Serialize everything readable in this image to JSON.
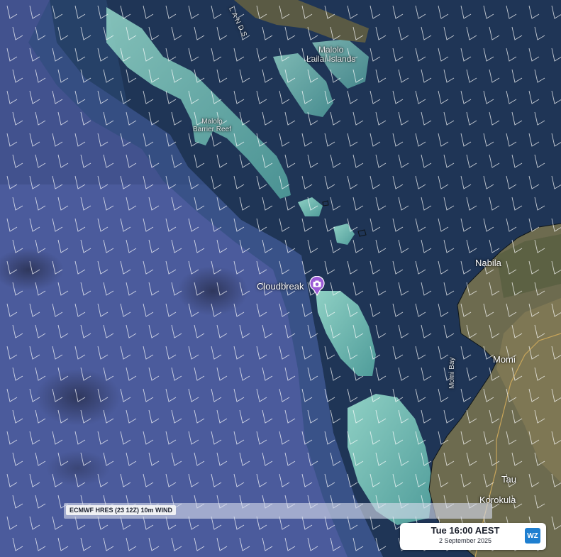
{
  "map": {
    "places": {
      "malolo_lailai": "Malolo\nLailai Islands",
      "malolo_barrier": "Malolo\nBarrier Reef",
      "cloudbreak": "Cloudbreak",
      "nabila": "Nabila",
      "momi": "Momi",
      "momi_bay": "Momi Bay",
      "tau": "Tau",
      "korokula": "Korokula",
      "islands_fragment": "LANDS"
    },
    "colors": {
      "deep_ocean": "#4a5a9a",
      "shelf_water": "#1f3454",
      "reef": "#7fc6bc",
      "land": "#6b6a50",
      "wind_barb": "#ffffff",
      "marker": "#9b5bd6"
    },
    "marker_icon": "camera-icon"
  },
  "overlay": {
    "model_label": "ECMWF HRES (23 12Z) 10m WIND"
  },
  "time_panel": {
    "time": "Tue 16:00 AEST",
    "date": "2 September 2025",
    "logo": "WZ"
  }
}
